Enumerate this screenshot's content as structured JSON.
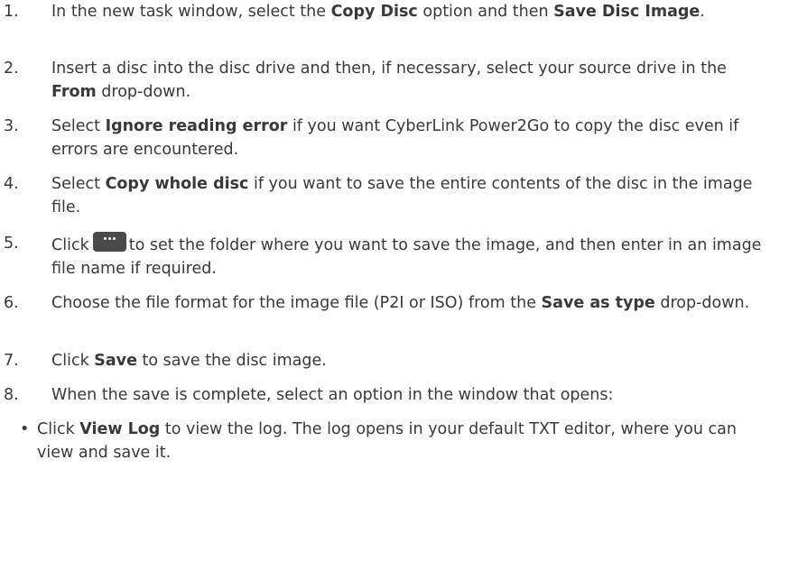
{
  "steps": [
    {
      "number": "1.",
      "pre": "In the new task window, select the ",
      "b1": "Copy Disc",
      "mid": " option and then ",
      "b2": "Save Disc Image",
      "post": "."
    },
    {
      "number": "2.",
      "pre": "Insert a disc into the disc drive and then, if necessary, select your source drive in the ",
      "b1": "From",
      "post": " drop-down."
    },
    {
      "number": "3.",
      "pre": "Select ",
      "b1": "Ignore reading error",
      "post": " if you want CyberLink Power2Go to copy the disc even if errors are encountered."
    },
    {
      "number": "4.",
      "pre": "Select ",
      "b1": "Copy whole disc",
      "post": " if you want to save the entire contents of the disc in the image file."
    },
    {
      "number": "5.",
      "pre": "Click",
      "button_icon": "more-options-icon",
      "post": "to set the folder where you want to save the image, and then enter in an image file name if required."
    },
    {
      "number": "6.",
      "pre": "Choose the file format for the image file (P2I or ISO) from the ",
      "b1": "Save as type",
      "post": " drop-down."
    },
    {
      "number": "7.",
      "pre": "Click ",
      "b1": "Save",
      "post": " to save the disc image."
    },
    {
      "number": "8.",
      "pre": "When the save is complete, select an option in the window that opens:"
    }
  ],
  "bullets": [
    {
      "symbol": "•",
      "pre": "Click ",
      "b1": "View Log",
      "post": " to view the log. The log opens in your default TXT editor, where you can view and save it."
    }
  ]
}
